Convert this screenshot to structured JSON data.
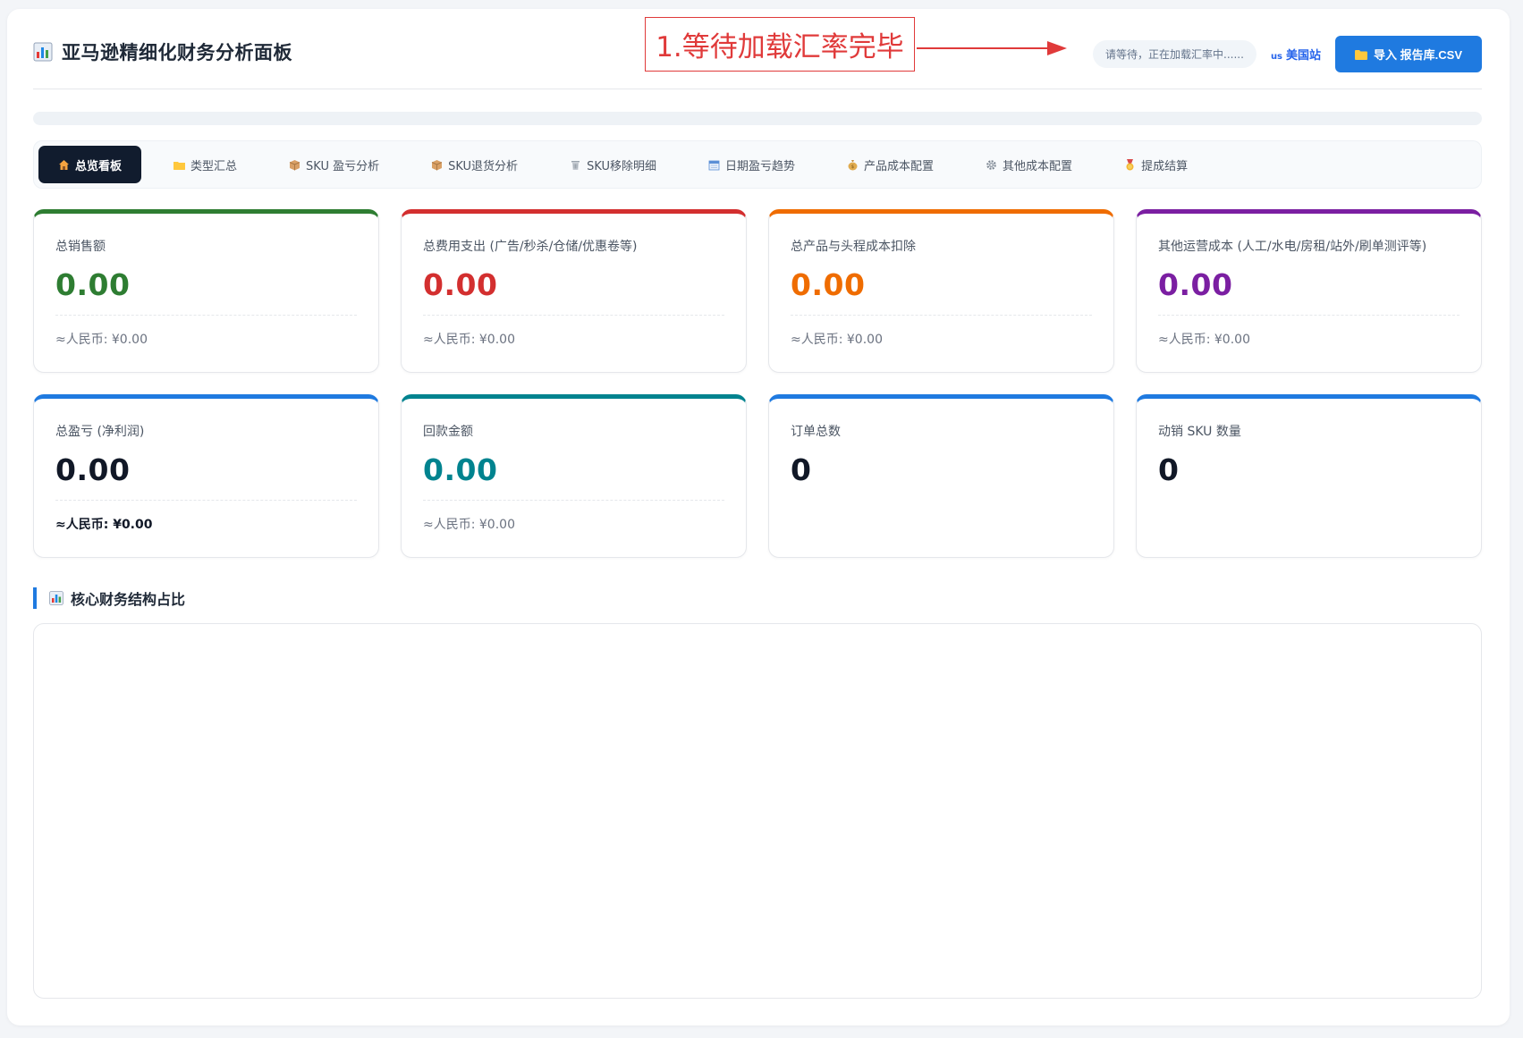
{
  "app": {
    "title": "亚马逊精细化财务分析面板",
    "loading_text": "请等待，正在加载汇率中......",
    "site_flag": "us",
    "site_label": "美国站",
    "import_label": "导入 报告库.CSV",
    "progress_fraction": 0
  },
  "annotation": {
    "text": "1.等待加载汇率完毕",
    "color": "#e03a3a"
  },
  "tabs": [
    {
      "label": "总览看板",
      "icon": "house-icon",
      "active": true
    },
    {
      "label": "类型汇总",
      "icon": "folder-icon"
    },
    {
      "label": "SKU 盈亏分析",
      "icon": "package-icon"
    },
    {
      "label": "SKU退货分析",
      "icon": "package-icon"
    },
    {
      "label": "SKU移除明细",
      "icon": "trash-icon"
    },
    {
      "label": "日期盈亏趋势",
      "icon": "calendar-icon"
    },
    {
      "label": "产品成本配置",
      "icon": "money-bag-icon"
    },
    {
      "label": "其他成本配置",
      "icon": "gear-icon"
    },
    {
      "label": "提成结算",
      "icon": "medal-icon"
    }
  ],
  "cards": [
    {
      "label": "总销售额",
      "value": "0.00",
      "sub": "≈人民币: ¥0.00",
      "color": "#2e7d32"
    },
    {
      "label": "总费用支出 (广告/秒杀/仓储/优惠卷等)",
      "value": "0.00",
      "sub": "≈人民币: ¥0.00",
      "color": "#d32f2f"
    },
    {
      "label": "总产品与头程成本扣除",
      "value": "0.00",
      "sub": "≈人民币: ¥0.00",
      "color": "#ef6c00"
    },
    {
      "label": "其他运营成本 (人工/水电/房租/站外/刷单测评等)",
      "value": "0.00",
      "sub": "≈人民币: ¥0.00",
      "color": "#7b1fa2"
    },
    {
      "label": "总盈亏 (净利润)",
      "value": "0.00",
      "sub": "≈人民币: ¥0.00",
      "color": "#1f7ae0",
      "value_color": "#111827",
      "sub_bold": true
    },
    {
      "label": "回款金额",
      "value": "0.00",
      "sub": "≈人民币: ¥0.00",
      "color": "#00838f"
    },
    {
      "label": "订单总数",
      "value": "0",
      "color": "#1f7ae0",
      "value_color": "#111827"
    },
    {
      "label": "动销 SKU 数量",
      "value": "0",
      "color": "#1f7ae0",
      "value_color": "#111827"
    }
  ],
  "section": {
    "title": "核心财务结构占比"
  }
}
